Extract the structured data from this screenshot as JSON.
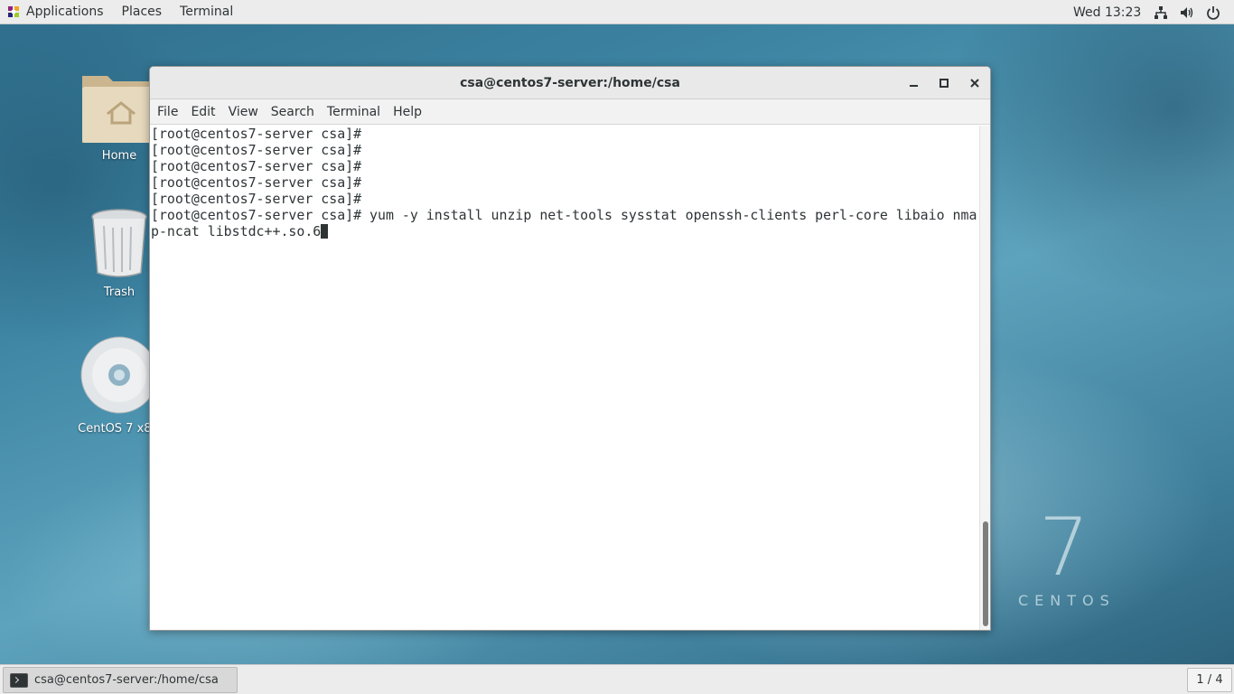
{
  "topbar": {
    "applications": "Applications",
    "places": "Places",
    "terminal": "Terminal",
    "clock": "Wed 13:23",
    "tray_icons": [
      "network-icon",
      "volume-icon",
      "power-icon"
    ]
  },
  "desktop": {
    "icons": [
      {
        "label": "Home",
        "icon": "home-folder-icon"
      },
      {
        "label": "Trash",
        "icon": "trash-icon"
      },
      {
        "label": "CentOS 7 x86",
        "icon": "disc-icon"
      }
    ],
    "watermark_number": "7",
    "watermark_text": "CENTOS"
  },
  "window": {
    "title": "csa@centos7-server:/home/csa",
    "menu": [
      "File",
      "Edit",
      "View",
      "Search",
      "Terminal",
      "Help"
    ],
    "lines": [
      "[root@centos7-server csa]#",
      "[root@centos7-server csa]#",
      "[root@centos7-server csa]#",
      "[root@centos7-server csa]#",
      "[root@centos7-server csa]#",
      "[root@centos7-server csa]# yum -y install unzip net-tools sysstat openssh-clients perl-core libaio nma",
      "p-ncat libstdc++.so.6"
    ]
  },
  "taskbar": {
    "task_label": "csa@centos7-server:/home/csa",
    "workspace": "1 / 4"
  },
  "colors": {
    "panel": "#ececec",
    "text": "#2e3436",
    "desktop": "#3e86a4"
  }
}
